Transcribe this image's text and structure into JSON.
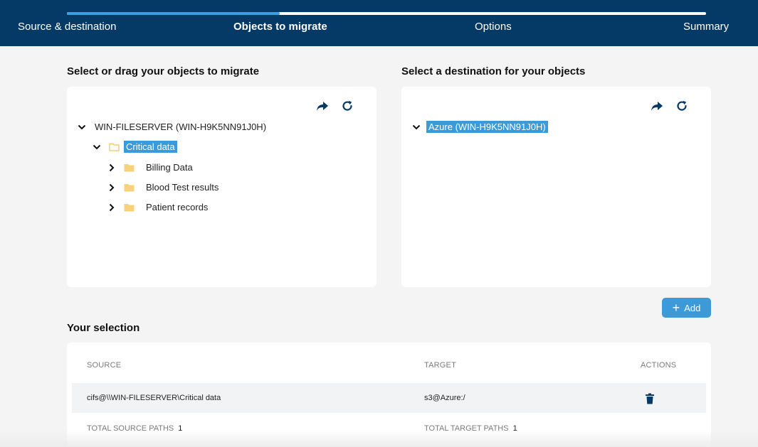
{
  "stepper": {
    "progress_fraction": 0.333,
    "steps": [
      {
        "label": "Source & destination",
        "active": false
      },
      {
        "label": "Objects to migrate",
        "active": true
      },
      {
        "label": "Options",
        "active": false
      },
      {
        "label": "Summary",
        "active": false
      }
    ]
  },
  "source_panel": {
    "title": "Select or drag your objects to migrate",
    "tools": [
      "share-arrow-icon",
      "refresh-icon"
    ],
    "tree": {
      "root": {
        "label": "WIN-FILESERVER (WIN-H9K5NN91J0H)",
        "expanded": true
      },
      "selected": {
        "label": "Critical data",
        "expanded": true
      },
      "children": [
        {
          "label": "Billing Data"
        },
        {
          "label": "Blood Test results"
        },
        {
          "label": "Patient records"
        }
      ]
    }
  },
  "destination_panel": {
    "title": "Select a destination for your objects",
    "tools": [
      "share-arrow-icon",
      "refresh-icon"
    ],
    "tree": {
      "root": {
        "label": "Azure (WIN-H9K5NN91J0H)",
        "expanded": true,
        "selected": true
      }
    }
  },
  "add_button": {
    "label": "Add"
  },
  "selection": {
    "title": "Your selection",
    "columns": {
      "source": "SOURCE",
      "target": "TARGET",
      "actions": "ACTIONS"
    },
    "rows": [
      {
        "source": "cifs@\\\\WIN-FILESERVER\\Critical data",
        "target": "s3@Azure:/",
        "action_icon": "trash-icon"
      }
    ],
    "totals": {
      "source_label": "TOTAL SOURCE PATHS",
      "source_count": "1",
      "target_label": "TOTAL TARGET PATHS",
      "target_count": "1"
    }
  },
  "colors": {
    "header_bg": "#063a66",
    "accent": "#3c9ad8",
    "progress_fill": "#39a0e0",
    "folder": "#f7d27a",
    "page_bg": "#f4f4f4"
  }
}
